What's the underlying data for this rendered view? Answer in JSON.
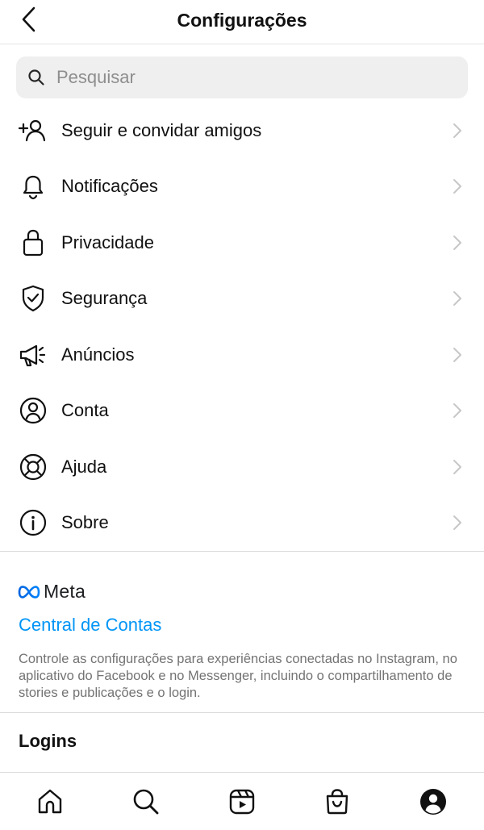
{
  "header": {
    "title": "Configurações"
  },
  "search": {
    "placeholder": "Pesquisar"
  },
  "menu": {
    "items": [
      {
        "label": "Seguir e convidar amigos",
        "icon": "add-person-icon"
      },
      {
        "label": "Notificações",
        "icon": "bell-icon"
      },
      {
        "label": "Privacidade",
        "icon": "lock-icon"
      },
      {
        "label": "Segurança",
        "icon": "shield-check-icon"
      },
      {
        "label": "Anúncios",
        "icon": "megaphone-icon"
      },
      {
        "label": "Conta",
        "icon": "user-circle-icon"
      },
      {
        "label": "Ajuda",
        "icon": "lifebuoy-icon"
      },
      {
        "label": "Sobre",
        "icon": "info-icon"
      }
    ]
  },
  "meta": {
    "logo_text": "Meta",
    "accounts_center": "Central de Contas",
    "description": "Controle as configurações para experiências conectadas no Instagram, no aplicativo do Facebook e no Messenger, incluindo o compartilhamento de stories e publicações e o login."
  },
  "logins": {
    "title": "Logins"
  },
  "tabbar": {
    "tabs": [
      "home-icon",
      "search-icon",
      "reels-icon",
      "shop-icon",
      "profile-icon"
    ]
  },
  "colors": {
    "link": "#0095f6",
    "meta_blue": "#0866ff"
  }
}
